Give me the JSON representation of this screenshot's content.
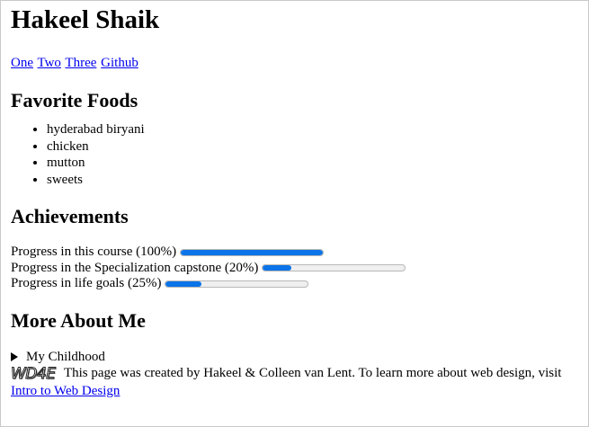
{
  "header": {
    "title": "Hakeel Shaik"
  },
  "nav": {
    "links": [
      "One",
      "Two",
      "Three",
      "Github"
    ]
  },
  "foods": {
    "title": "Favorite Foods",
    "items": [
      "hyderabad biryani",
      "chicken",
      "mutton",
      "sweets"
    ]
  },
  "achievements": {
    "title": "Achievements",
    "items": [
      {
        "label": "Progress in this course (100%)",
        "value": 1.0
      },
      {
        "label": "Progress in the Specialization capstone (20%)",
        "value": 0.2
      },
      {
        "label": "Progress in life goals (25%)",
        "value": 0.25
      }
    ]
  },
  "more": {
    "title": "More About Me",
    "details_summary": "My Childhood"
  },
  "footer": {
    "logo_text": "WD4E",
    "text": "This page was created by Hakeel & Colleen van Lent. To learn more about web design, visit",
    "link": "Intro to Web Design"
  },
  "colors": {
    "link": "#0000ee",
    "progress_fill": "#0b74e8"
  }
}
